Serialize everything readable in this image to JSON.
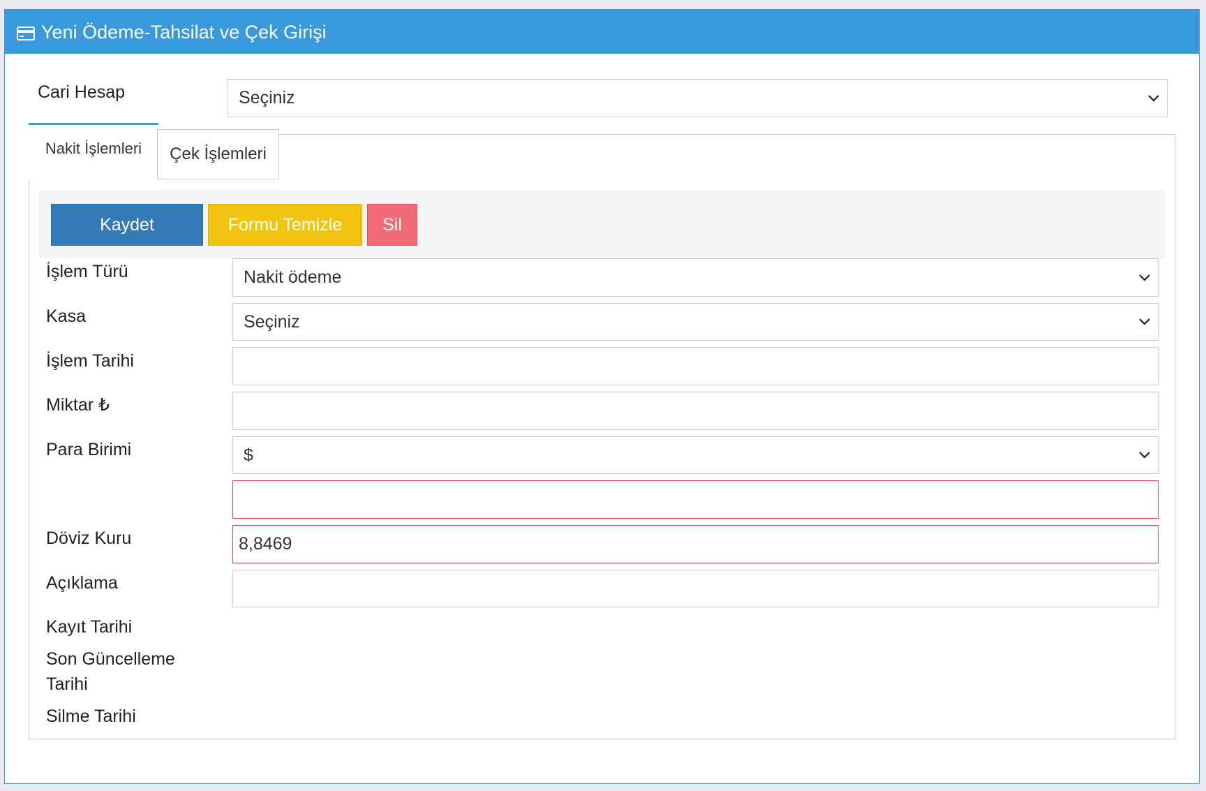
{
  "header": {
    "title": "Yeni Ödeme-Tahsilat ve Çek Girişi",
    "icon": "credit-card-icon"
  },
  "cari_hesap": {
    "label": "Cari Hesap",
    "value": "Seçiniz"
  },
  "tabs": [
    {
      "label": "Nakit İşlemleri",
      "active": true
    },
    {
      "label": "Çek İşlemleri",
      "active": false
    }
  ],
  "toolbar": {
    "save_label": "Kaydet",
    "clear_label": "Formu Temizle",
    "delete_label": "Sil"
  },
  "form": {
    "islem_turu": {
      "label": "İşlem Türü",
      "value": "Nakit ödeme"
    },
    "kasa": {
      "label": "Kasa",
      "value": "Seçiniz"
    },
    "islem_tarihi": {
      "label": "İşlem Tarihi",
      "value": ""
    },
    "miktar": {
      "label": "Miktar ₺",
      "value": ""
    },
    "para_birimi": {
      "label": "Para Birimi",
      "value": "$"
    },
    "extra_value": "",
    "doviz_kuru": {
      "label": "Döviz Kuru",
      "value": "8,8469"
    },
    "aciklama": {
      "label": "Açıklama",
      "value": ""
    },
    "kayit_tarihi": {
      "label": "Kayıt Tarihi"
    },
    "son_guncelleme": {
      "label_line1": "Son Güncelleme",
      "label_line2": "Tarihi"
    },
    "silme_tarihi": {
      "label": "Silme Tarihi"
    }
  },
  "colors": {
    "header": "#3899dd",
    "save": "#337ab7",
    "clear": "#f1c40f",
    "delete": "#f06a78",
    "error_border": "#e0404f"
  }
}
